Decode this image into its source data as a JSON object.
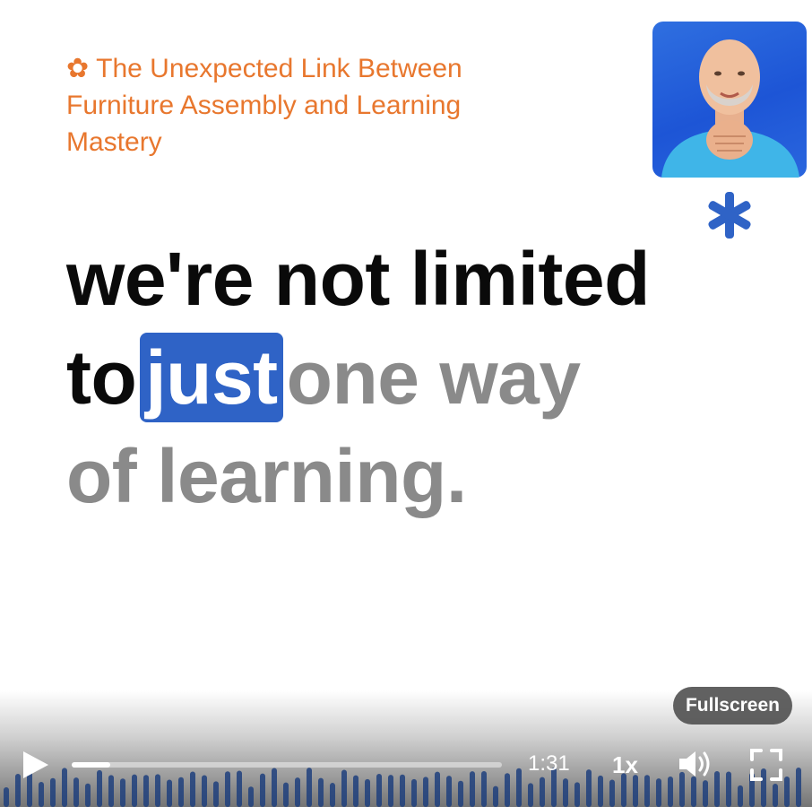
{
  "header": {
    "title_icon": "✿",
    "title": "The Unexpected Link Between Furniture Assembly and Learning Mastery"
  },
  "avatar": {
    "icon": "presenter-avatar"
  },
  "brand": {
    "icon": "asterisk-logo",
    "color": "#2f63c6"
  },
  "caption": {
    "line1": "we're not limited",
    "line2_spoken": "to",
    "line2_current": "just",
    "line2_pending": "one way",
    "line3_pending": "of learning."
  },
  "player": {
    "fullscreen_tooltip": "Fullscreen",
    "time": "1:31",
    "speed": "1x",
    "progress": 0.09,
    "icons": [
      "play-icon",
      "volume-icon",
      "fullscreen-icon"
    ]
  },
  "colors": {
    "title": "#e8772e",
    "highlight": "#2f63c6",
    "spoken": "#0a0a0a",
    "pending": "#8a8a8a",
    "waveform": "#1f3f7d"
  }
}
